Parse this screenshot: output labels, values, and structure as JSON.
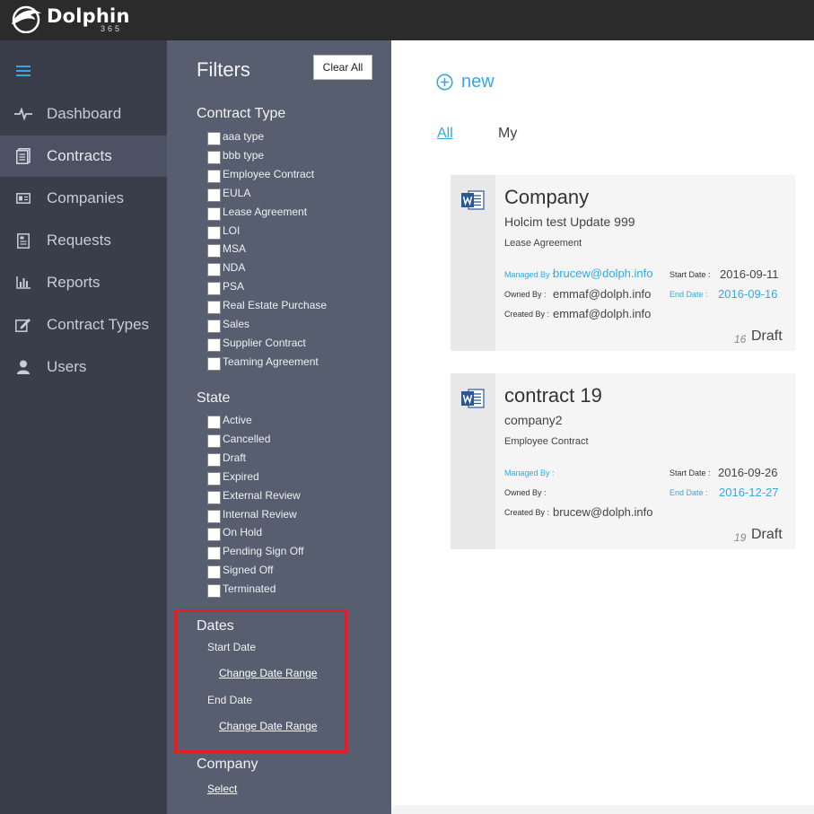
{
  "app": {
    "name": "Dolphin",
    "sub": "365"
  },
  "nav": {
    "items": [
      {
        "label": "Dashboard",
        "icon": "pulse-icon"
      },
      {
        "label": "Contracts",
        "icon": "document-stack-icon",
        "active": true
      },
      {
        "label": "Companies",
        "icon": "id-card-icon"
      },
      {
        "label": "Requests",
        "icon": "request-form-icon"
      },
      {
        "label": "Reports",
        "icon": "bar-chart-icon"
      },
      {
        "label": "Contract Types",
        "icon": "edit-icon"
      },
      {
        "label": "Users",
        "icon": "user-icon"
      }
    ]
  },
  "filters": {
    "title": "Filters",
    "clear_all": "Clear All",
    "contract_type": {
      "title": "Contract Type",
      "options": [
        "aaa type",
        "bbb type",
        "Employee Contract",
        "EULA",
        "Lease Agreement",
        "LOI",
        "MSA",
        "NDA",
        "PSA",
        "Real Estate Purchase",
        "Sales",
        "Supplier Contract",
        "Teaming Agreement"
      ]
    },
    "state": {
      "title": "State",
      "options": [
        "Active",
        "Cancelled",
        "Draft",
        "Expired",
        "External Review",
        "Internal Review",
        "On Hold",
        "Pending Sign Off",
        "Signed Off",
        "Terminated"
      ]
    },
    "dates": {
      "title": "Dates",
      "start_label": "Start Date",
      "end_label": "End Date",
      "change_range": "Change Date Range"
    },
    "company": {
      "title": "Company",
      "select": "Select"
    }
  },
  "main": {
    "new_label": "new",
    "tabs": {
      "all": "All",
      "my": "My"
    },
    "labels": {
      "managed_by": "Managed By :",
      "owned_by": "Owned By :",
      "created_by": "Created By :",
      "start_date": "Start Date :",
      "end_date": "End Date :"
    },
    "cards": [
      {
        "title": "Company",
        "company": "Holcim test Update 999",
        "type": "Lease Agreement",
        "managed_by": "brucew@dolph.info",
        "owned_by": "emmaf@dolph.info",
        "created_by": "emmaf@dolph.info",
        "start_date": "2016-09-11",
        "end_date": "2016-09-16",
        "number": "16",
        "status": "Draft"
      },
      {
        "title": "contract 19",
        "company": "company2",
        "type": "Employee Contract",
        "managed_by": "",
        "owned_by": "",
        "created_by": "brucew@dolph.info",
        "start_date": "2016-09-26",
        "end_date": "2016-12-27",
        "number": "19",
        "status": "Draft"
      }
    ]
  },
  "colors": {
    "accent": "#36a8e0",
    "highlight": "#e01e24",
    "nav_bg": "#3a3e4a",
    "filters_bg": "#565e6f"
  }
}
